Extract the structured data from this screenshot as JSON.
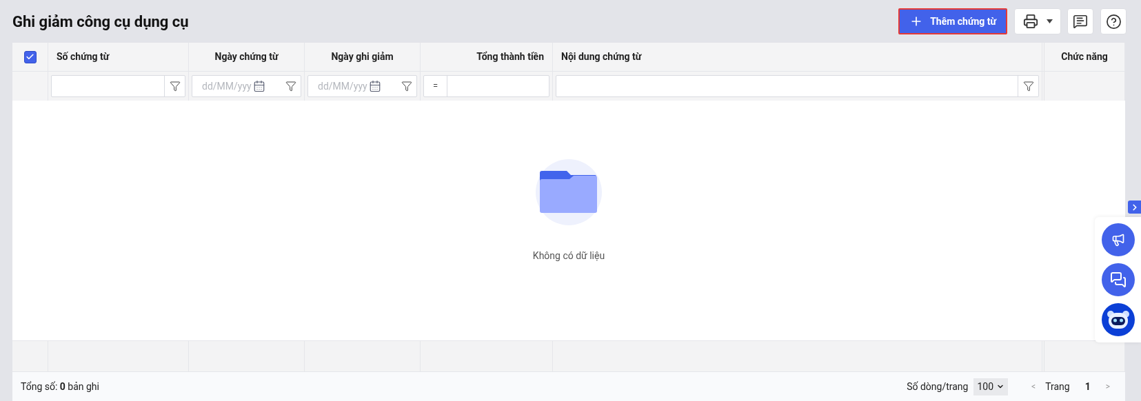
{
  "page": {
    "title": "Ghi giảm công cụ dụng cụ"
  },
  "toolbar": {
    "add_button": "Thêm chứng từ"
  },
  "table": {
    "select_all": {
      "checked": true
    },
    "columns": [
      {
        "label": "Số chứng từ",
        "filter": {
          "kind": "text"
        }
      },
      {
        "label": "Ngày chứng từ",
        "filter": {
          "kind": "date",
          "placeholder": "dd/MM/yyy"
        }
      },
      {
        "label": "Ngày ghi giảm",
        "filter": {
          "kind": "date",
          "placeholder": "dd/MM/yyy"
        }
      },
      {
        "label": "Tổng thành tiền",
        "filter": {
          "kind": "number",
          "operator": "="
        }
      },
      {
        "label": "Nội dung chứng từ",
        "filter": {
          "kind": "text"
        }
      },
      {
        "label": "Chức năng",
        "filter": {
          "kind": "none"
        }
      }
    ],
    "empty_message": "Không có dữ liệu"
  },
  "footer": {
    "total": "Tổng số: **0** bản ghi",
    "page_size_label": "Số dòng/trang",
    "page_size": "100",
    "prev": "<",
    "page_label": "Trang",
    "page": "1",
    "next": ">"
  }
}
